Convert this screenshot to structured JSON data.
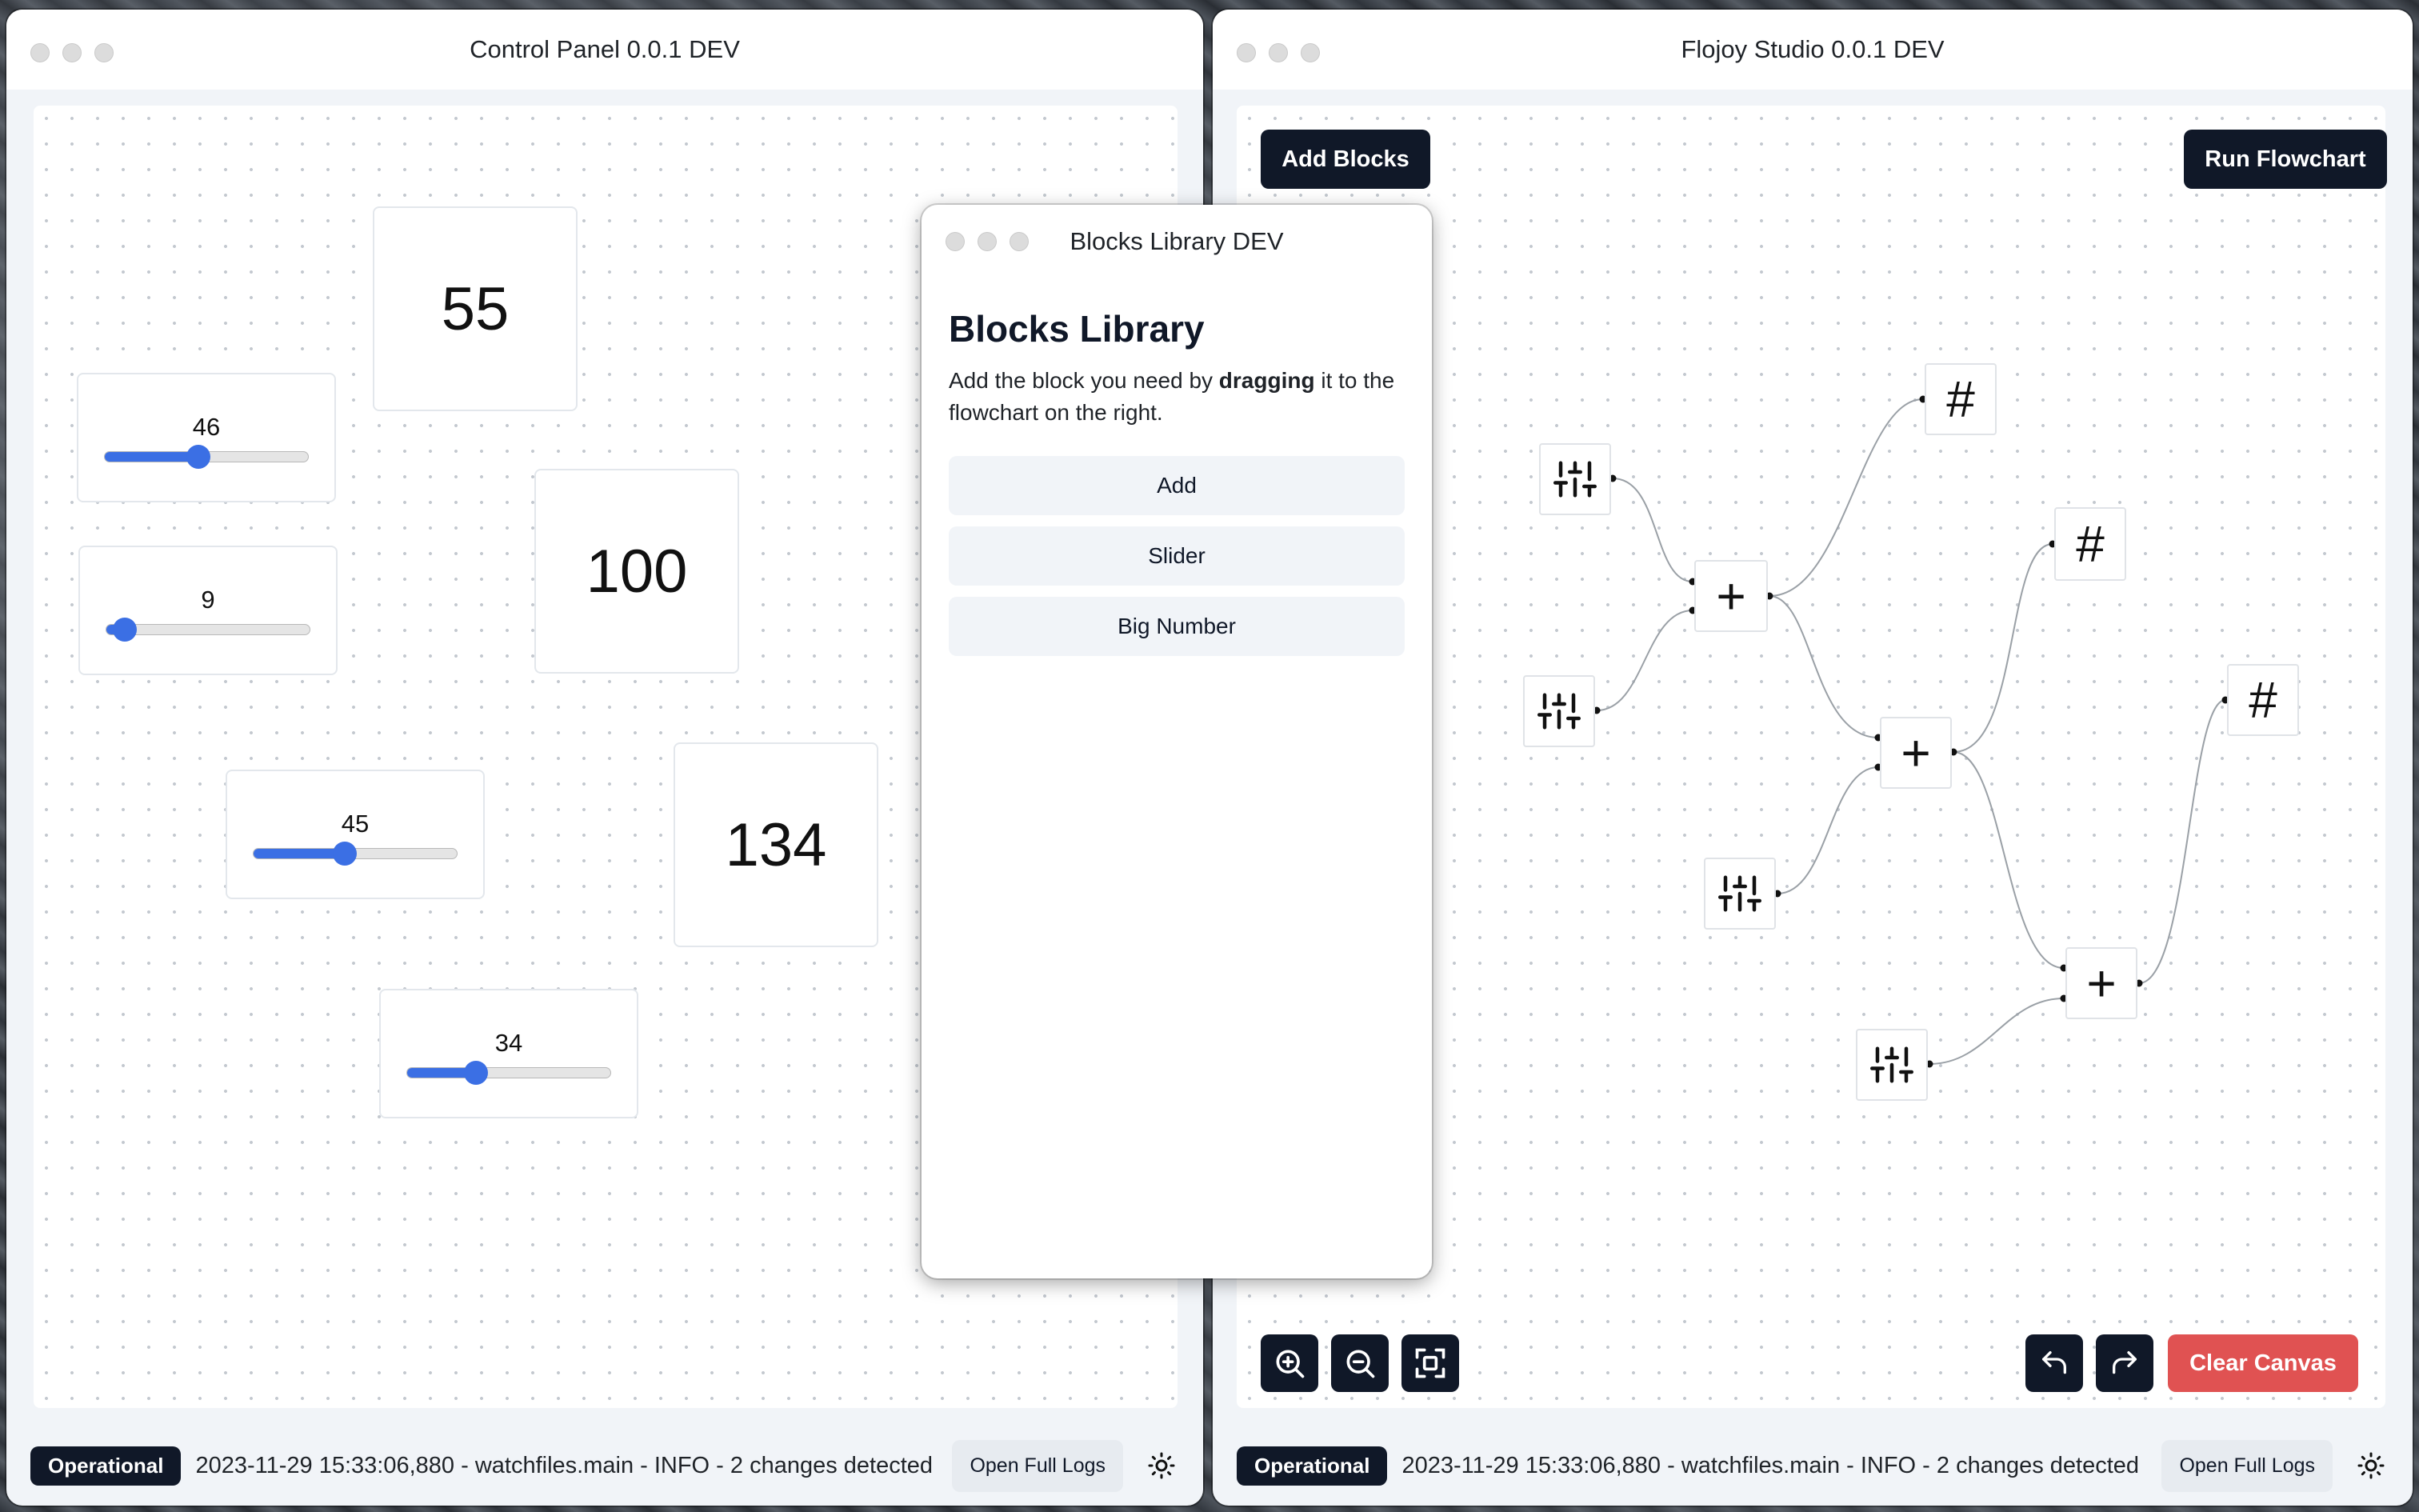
{
  "control_panel": {
    "title": "Control Panel 0.0.1 DEV",
    "big_numbers": [
      "55",
      "100",
      "134"
    ],
    "sliders": [
      {
        "value": "46",
        "fraction": 0.46
      },
      {
        "value": "9",
        "fraction": 0.09
      },
      {
        "value": "45",
        "fraction": 0.45
      },
      {
        "value": "34",
        "fraction": 0.34
      }
    ],
    "status": {
      "badge": "Operational",
      "log": "2023-11-29 15:33:06,880 - watchfiles.main - INFO - 2 changes detected",
      "open_logs": "Open Full Logs"
    }
  },
  "studio": {
    "title": "Flojoy Studio 0.0.1 DEV",
    "add_blocks": "Add Blocks",
    "run_flowchart": "Run Flowchart",
    "clear_canvas": "Clear Canvas",
    "node_glyphs": {
      "add": "+",
      "big_number": "#"
    },
    "status": {
      "badge": "Operational",
      "log": "2023-11-29 15:33:06,880 - watchfiles.main - INFO - 2 changes detected",
      "open_logs": "Open Full Logs"
    }
  },
  "library": {
    "title": "Blocks Library DEV",
    "heading": "Blocks Library",
    "desc_pre": "Add the block you need by ",
    "desc_bold": "dragging",
    "desc_post": " it to the flowchart on the right.",
    "items": [
      "Add",
      "Slider",
      "Big Number"
    ]
  },
  "colors": {
    "accent": "#3b6fe4",
    "dark": "#101828",
    "danger": "#e05252"
  }
}
